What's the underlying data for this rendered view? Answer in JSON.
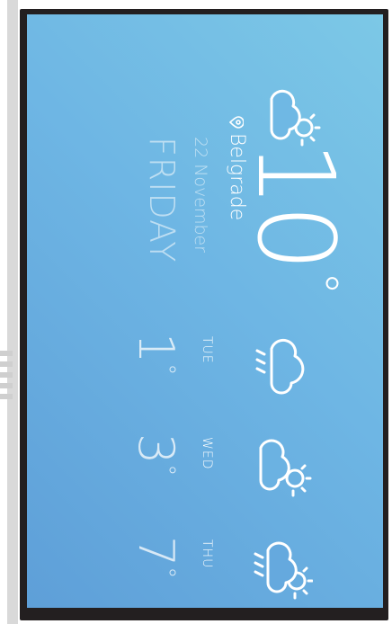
{
  "current": {
    "temperature": "10",
    "degree_symbol": "°",
    "icon": "sun-cloud-icon",
    "location": "Belgrade",
    "date": "22 November",
    "day": "FRIDAY"
  },
  "forecast": [
    {
      "day": "TUE",
      "temperature": "1",
      "icon": "cloud-rain-icon"
    },
    {
      "day": "WED",
      "temperature": "3",
      "icon": "sun-cloud-icon"
    },
    {
      "day": "THU",
      "temperature": "7",
      "icon": "sun-cloud-rain-icon"
    }
  ],
  "colors": {
    "device_frame": "#231f20",
    "screen_gradient_top": "#7cc8e6",
    "screen_gradient_bottom": "#5e9fd8",
    "text": "#ffffff"
  }
}
